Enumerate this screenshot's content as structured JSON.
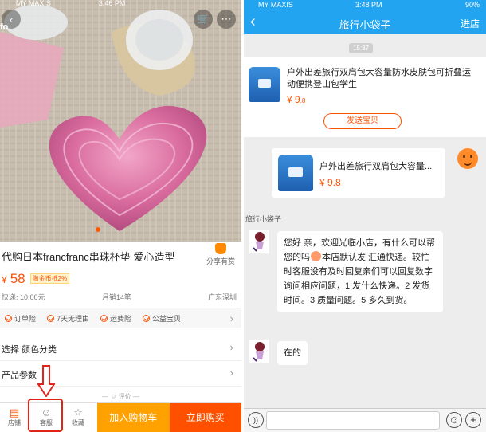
{
  "left": {
    "status": {
      "carrier": "MY MAXIS",
      "time": "3:46 PM"
    },
    "hero_overlay_text": "fo",
    "product_title": "代购日本francfranc串珠杯垫 爱心造型",
    "share_label": "分享有赏",
    "price_symbol": "¥",
    "price": "58",
    "price_tag": "淘金币抵2%",
    "shipping": "快递: 10.00元",
    "monthly_sales": "月销14笔",
    "location": "广东深圳",
    "services": [
      "订单险",
      "7天无理由",
      "运费险",
      "公益宝贝"
    ],
    "option_select": "选择 颜色分类",
    "option_params": "产品参数",
    "review_divider": "评价",
    "toolbar": {
      "shop": "店铺",
      "service": "客服",
      "favorite": "收藏",
      "add_cart": "加入购物车",
      "buy_now": "立即购买"
    },
    "colors": {
      "accent": "#ff5000",
      "cart": "#ffa200",
      "highlight_box": "#e0241b"
    }
  },
  "right": {
    "status": {
      "carrier": "MY MAXIS",
      "time": "3:48 PM",
      "battery": "90%"
    },
    "header_title": "旅行小袋子",
    "header_enter": "进店",
    "timestamp": "15:37",
    "product_card": {
      "title": "户外出差旅行双肩包大容量防水皮肤包可折叠运动便携登山包学生",
      "price_int": "¥ 9",
      "price_dec": ".8",
      "send_button": "发送宝贝"
    },
    "sent_message": {
      "title": "户外出差旅行双肩包大容量...",
      "price": "¥ 9.8"
    },
    "sender_name": "旅行小袋子",
    "reply1_a": "您好 亲，欢迎光临小店，有什么可以帮您的吗",
    "reply1_b": "本店默认发  汇通快递。较忙时客服没有及时回复亲们可以回复数字询问相应问题，1 发什么快递。2 发货时间。3 质量问题。5 多久到货。",
    "reply2": "在的",
    "colors": {
      "header": "#22a4f0",
      "price": "#ff5000"
    }
  }
}
